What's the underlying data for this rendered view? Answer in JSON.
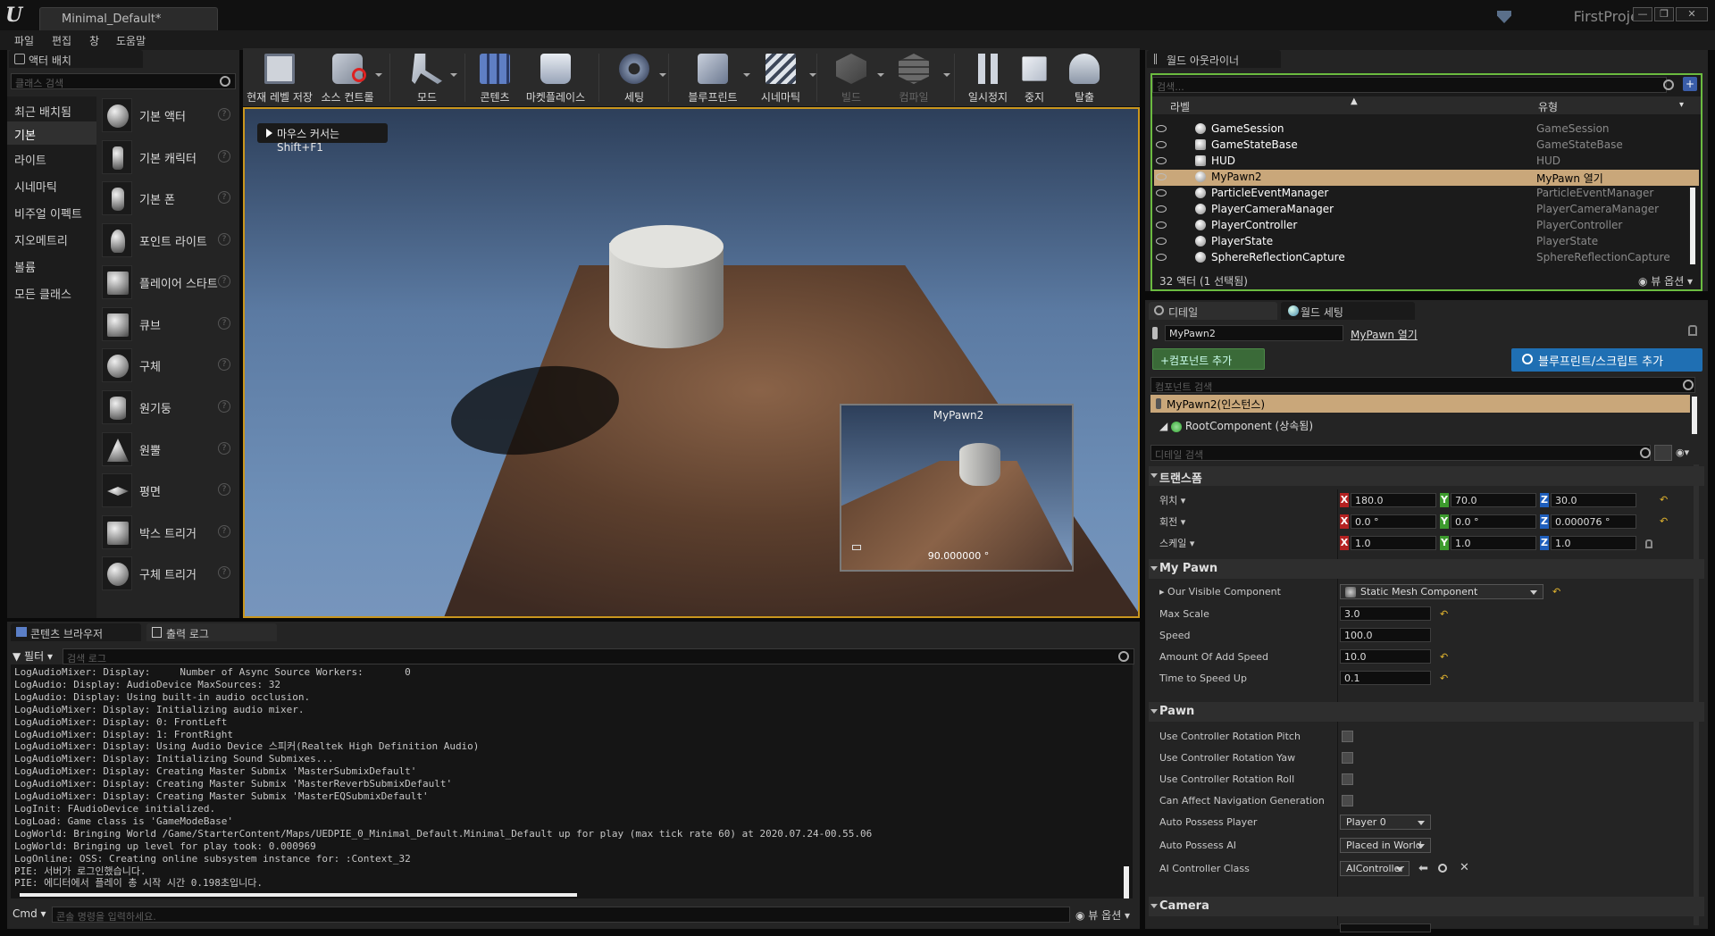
{
  "window": {
    "doc_tab": "Minimal_Default*",
    "project": "FirstProject",
    "buttons": [
      "—",
      "❐",
      "✕"
    ]
  },
  "menu": [
    "파일",
    "편집",
    "창",
    "도움말"
  ],
  "place_actors": {
    "tab": "액터 배치",
    "search_placeholder": "클래스 검색",
    "categories": [
      "최근 배치됨",
      "기본",
      "라이트",
      "시네마틱",
      "비주얼 이펙트",
      "지오메트리",
      "볼륨",
      "모든 클래스"
    ],
    "active_category": "기본",
    "assets": [
      "기본 액터",
      "기본 캐릭터",
      "기본 폰",
      "포인트 라이트",
      "플레이어 스타트",
      "큐브",
      "구체",
      "원기둥",
      "원뿔",
      "평면",
      "박스 트리거",
      "구체 트리거"
    ]
  },
  "toolbar": {
    "buttons": [
      {
        "label": "현재 레벨 저장",
        "icon": "save-icon"
      },
      {
        "label": "소스 컨트롤",
        "icon": "source-control-icon"
      },
      {
        "label": "모드",
        "icon": "modes-icon"
      },
      {
        "label": "콘텐츠",
        "icon": "content-icon"
      },
      {
        "label": "마켓플레이스",
        "icon": "marketplace-icon"
      },
      {
        "label": "세팅",
        "icon": "settings-icon"
      },
      {
        "label": "블루프린트",
        "icon": "blueprint-icon"
      },
      {
        "label": "시네마틱",
        "icon": "cinematic-icon"
      },
      {
        "label": "빌드",
        "icon": "build-icon"
      },
      {
        "label": "컴파일",
        "icon": "compile-icon"
      },
      {
        "label": "일시정지",
        "icon": "pause-icon"
      },
      {
        "label": "중지",
        "icon": "stop-icon"
      },
      {
        "label": "탈출",
        "icon": "eject-icon"
      }
    ]
  },
  "viewport": {
    "hint": "마우스 커서는 Shift+F1",
    "pip_title": "MyPawn2",
    "pip_fov": "90.000000 °"
  },
  "bottom": {
    "tabs": [
      "콘텐츠 브라우저",
      "출력 로그"
    ],
    "filter": "필터",
    "search_placeholder": "검색 로그",
    "log_lines": [
      "LogAudioMixer: Display:     Number of Async Source Workers:       0",
      "LogAudio: Display: AudioDevice MaxSources: 32",
      "LogAudio: Display: Using built-in audio occlusion.",
      "LogAudioMixer: Display: Initializing audio mixer.",
      "LogAudioMixer: Display: 0: FrontLeft",
      "LogAudioMixer: Display: 1: FrontRight",
      "LogAudioMixer: Display: Using Audio Device 스피커(Realtek High Definition Audio)",
      "LogAudioMixer: Display: Initializing Sound Submixes...",
      "LogAudioMixer: Display: Creating Master Submix 'MasterSubmixDefault'",
      "LogAudioMixer: Display: Creating Master Submix 'MasterReverbSubmixDefault'",
      "LogAudioMixer: Display: Creating Master Submix 'MasterEQSubmixDefault'",
      "LogInit: FAudioDevice initialized.",
      "LogLoad: Game class is 'GameModeBase'",
      "LogWorld: Bringing World /Game/StarterContent/Maps/UEDPIE_0_Minimal_Default.Minimal_Default up for play (max tick rate 60) at 2020.07.24-00.55.06",
      "LogWorld: Bringing up level for play took: 0.000969",
      "LogOnline: OSS: Creating online subsystem instance for: :Context_32",
      "PIE: 서버가 로그인했습니다.",
      "PIE: 에디터에서 플레이 총 시작 시간 0.198초입니다."
    ],
    "cmd_label": "Cmd",
    "cmd_placeholder": "콘솔 명령을 입력하세요.",
    "view_options": "뷰 옵션"
  },
  "outliner": {
    "tab": "월드 아웃라이너",
    "search_placeholder": "검색...",
    "col_label": "라벨",
    "col_type": "유형",
    "rows": [
      {
        "name": "GameSession",
        "type": "GameSession"
      },
      {
        "name": "GameStateBase",
        "type": "GameStateBase"
      },
      {
        "name": "HUD",
        "type": "HUD"
      },
      {
        "name": "MyPawn2",
        "type": "MyPawn 열기",
        "selected": true
      },
      {
        "name": "ParticleEventManager",
        "type": "ParticleEventManager"
      },
      {
        "name": "PlayerCameraManager",
        "type": "PlayerCameraManager"
      },
      {
        "name": "PlayerController",
        "type": "PlayerController"
      },
      {
        "name": "PlayerState",
        "type": "PlayerState"
      },
      {
        "name": "SphereReflectionCapture",
        "type": "SphereReflectionCapture"
      }
    ],
    "status": "32 액터 (1 선택됨)",
    "view_options": "뷰 옵션"
  },
  "details": {
    "tabs": [
      "디테일",
      "월드 세팅"
    ],
    "name_value": "MyPawn2",
    "open_link": "MyPawn 열기",
    "add_component": "+컴포넌트 추가",
    "add_blueprint": "블루프린트/스크립트 추가",
    "comp_search": "컴포넌트 검색",
    "comp_instance": "MyPawn2(인스턴스)",
    "comp_root": "RootComponent (상속됨)",
    "details_search": "디테일 검색",
    "transform": {
      "title": "트랜스폼",
      "location_label": "위치",
      "rotation_label": "회전",
      "scale_label": "스케일",
      "location": [
        "180.0",
        "70.0",
        "30.0"
      ],
      "rotation": [
        "0.0 °",
        "0.0 °",
        "0.000076 °"
      ],
      "scale": [
        "1.0",
        "1.0",
        "1.0"
      ]
    },
    "mypawn": {
      "title": "My Pawn",
      "visible_component_label": "Our Visible Component",
      "visible_component_value": "Static Mesh Component",
      "max_scale_label": "Max Scale",
      "max_scale": "3.0",
      "speed_label": "Speed",
      "speed": "100.0",
      "add_speed_label": "Amount Of Add Speed",
      "add_speed": "10.0",
      "time_label": "Time to Speed Up",
      "time": "0.1"
    },
    "pawn": {
      "title": "Pawn",
      "checks": [
        "Use Controller Rotation Pitch",
        "Use Controller Rotation Yaw",
        "Use Controller Rotation Roll",
        "Can Affect Navigation Generation"
      ],
      "auto_possess_player_label": "Auto Possess Player",
      "auto_possess_player": "Player 0",
      "auto_possess_ai_label": "Auto Possess AI",
      "auto_possess_ai": "Placed in World",
      "ai_class_label": "AI Controller Class",
      "ai_class": "AIController"
    },
    "camera_title": "Camera"
  }
}
